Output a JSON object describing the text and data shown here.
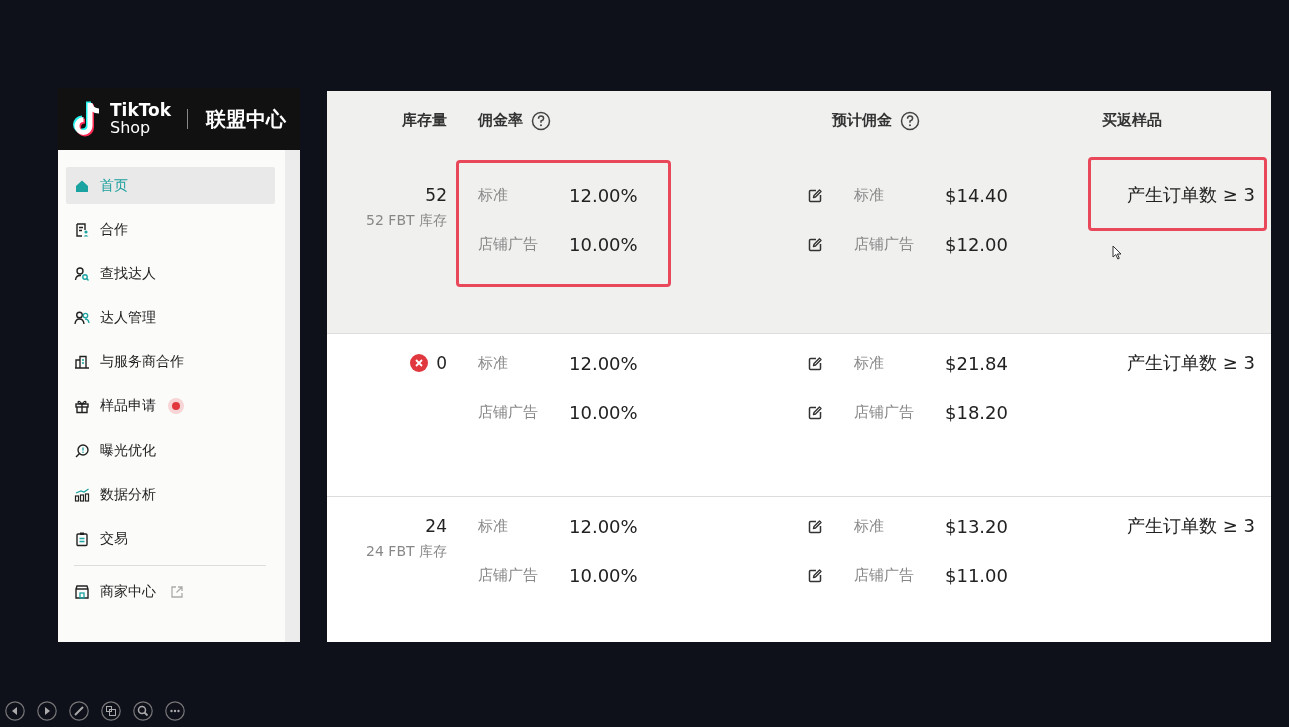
{
  "sidebar": {
    "brand": {
      "line1": "TikTok",
      "line2": "Shop",
      "title": "联盟中心"
    },
    "items": [
      {
        "label": "首页",
        "selected": true,
        "dot": false
      },
      {
        "label": "合作",
        "selected": false,
        "dot": false
      },
      {
        "label": "查找达人",
        "selected": false,
        "dot": false
      },
      {
        "label": "达人管理",
        "selected": false,
        "dot": false
      },
      {
        "label": "与服务商合作",
        "selected": false,
        "dot": false
      },
      {
        "label": "样品申请",
        "selected": false,
        "dot": true
      },
      {
        "label": "曝光优化",
        "selected": false,
        "dot": false
      },
      {
        "label": "数据分析",
        "selected": false,
        "dot": false
      },
      {
        "label": "交易",
        "selected": false,
        "dot": false
      }
    ],
    "footer_items": [
      {
        "label": "商家中心",
        "selected": false,
        "external": true
      }
    ]
  },
  "table": {
    "columns": [
      {
        "label": "库存量",
        "help": false
      },
      {
        "label": "佣金率",
        "help": true
      },
      {
        "label": "预计佣金",
        "help": true
      },
      {
        "label": "买返样品",
        "help": false
      }
    ],
    "rows": [
      {
        "hovered": true,
        "stock": "52",
        "stock_note": "52 FBT 库存",
        "out_of_stock": false,
        "rates": [
          {
            "label": "标准",
            "value": "12.00%"
          },
          {
            "label": "店铺广告",
            "value": "10.00%"
          }
        ],
        "rates_highlighted": true,
        "commissions": [
          {
            "label": "标准",
            "value": "$14.40"
          },
          {
            "label": "店铺广告",
            "value": "$12.00"
          }
        ],
        "sample": "产生订单数 ≥ 3",
        "sample_highlighted": true
      },
      {
        "hovered": false,
        "stock": "0",
        "out_of_stock": true,
        "rates": [
          {
            "label": "标准",
            "value": "12.00%"
          },
          {
            "label": "店铺广告",
            "value": "10.00%"
          }
        ],
        "rates_highlighted": false,
        "commissions": [
          {
            "label": "标准",
            "value": "$21.84"
          },
          {
            "label": "店铺广告",
            "value": "$18.20"
          }
        ],
        "sample": "产生订单数 ≥ 3",
        "sample_highlighted": false
      },
      {
        "hovered": false,
        "stock": "24",
        "stock_note": "24 FBT 库存",
        "out_of_stock": false,
        "rates": [
          {
            "label": "标准",
            "value": "12.00%"
          },
          {
            "label": "店铺广告",
            "value": "10.00%"
          }
        ],
        "rates_highlighted": false,
        "commissions": [
          {
            "label": "标准",
            "value": "$13.20"
          },
          {
            "label": "店铺广告",
            "value": "$11.00"
          }
        ],
        "sample": "产生订单数 ≥ 3",
        "sample_highlighted": false
      }
    ]
  }
}
